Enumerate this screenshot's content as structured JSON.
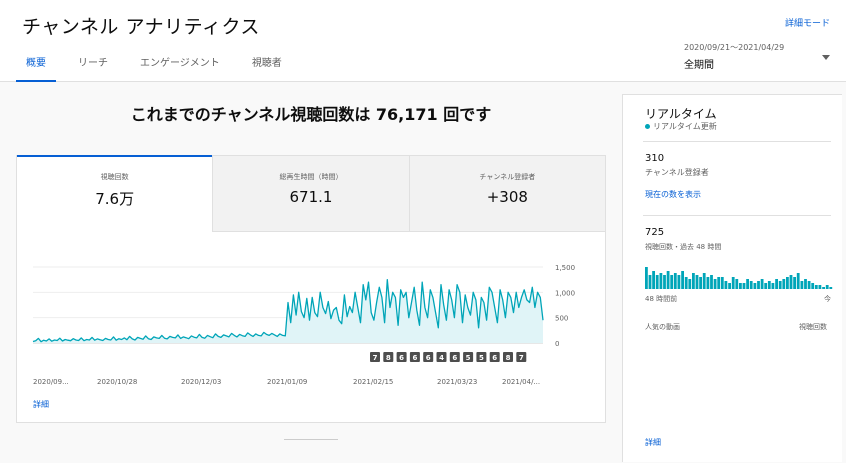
{
  "header": {
    "title": "チャンネル アナリティクス",
    "detail_mode": "詳細モード",
    "tabs": [
      {
        "label": "概要",
        "active": true
      },
      {
        "label": "リーチ",
        "active": false
      },
      {
        "label": "エンゲージメント",
        "active": false
      },
      {
        "label": "視聴者",
        "active": false
      }
    ],
    "date_range": "2020/09/21～2021/04/29",
    "period": "全期間"
  },
  "main": {
    "headline": "これまでのチャンネル視聴回数は 76,171 回です",
    "metrics": [
      {
        "label": "視聴回数",
        "value": "7.6万"
      },
      {
        "label": "総再生時間（時間）",
        "value": "671.1"
      },
      {
        "label": "チャンネル登録者",
        "value": "+308"
      }
    ],
    "detail_link": "詳細"
  },
  "chart_data": {
    "type": "area",
    "series_color": "#00a5b8",
    "fill_color": "#e0f4f7",
    "yticks": [
      "1,500",
      "1,000",
      "500",
      "0"
    ],
    "ylim": [
      0,
      1500
    ],
    "xticks": [
      "2020/09...",
      "2020/10/28",
      "2020/12/03",
      "2021/01/09",
      "2021/02/15",
      "2021/03/23",
      "2021/04/..."
    ],
    "markers": [
      "7",
      "8",
      "6",
      "6",
      "6",
      "4",
      "6",
      "5",
      "5",
      "6",
      "8",
      "7"
    ],
    "values": [
      30,
      45,
      90,
      25,
      55,
      40,
      80,
      35,
      60,
      50,
      95,
      40,
      70,
      55,
      45,
      85,
      60,
      50,
      100,
      45,
      70,
      60,
      110,
      55,
      80,
      65,
      50,
      90,
      70,
      60,
      120,
      55,
      85,
      70,
      100,
      65,
      130,
      80,
      60,
      110,
      90,
      75,
      140,
      85,
      70,
      120,
      100,
      90,
      150,
      95,
      80,
      130,
      110,
      100,
      160,
      90,
      120,
      105,
      85,
      140,
      115,
      100,
      170,
      110,
      95,
      150,
      125,
      105,
      180,
      130,
      110,
      160,
      140,
      120,
      190,
      150,
      120,
      170,
      145,
      130,
      200,
      160,
      130,
      180,
      150,
      140,
      210,
      170,
      150,
      190,
      160,
      130,
      180,
      150,
      140,
      800,
      400,
      950,
      550,
      1000,
      620,
      500,
      880,
      450,
      900,
      600,
      520,
      1000,
      700,
      580,
      820,
      480,
      650,
      700,
      450,
      380,
      950,
      520,
      720,
      600,
      1000,
      700,
      400,
      1150,
      850,
      1200,
      600,
      450,
      800,
      1100,
      900,
      400,
      1250,
      700,
      1000,
      900,
      350,
      1050,
      900,
      1000,
      500,
      800,
      1100,
      650,
      350,
      1200,
      700,
      500,
      1050,
      900,
      600,
      300,
      1150,
      750,
      450,
      1050,
      850,
      500,
      1150,
      1000,
      400,
      950,
      700,
      550,
      1000,
      850,
      300,
      900,
      800,
      450,
      1100,
      1000,
      700,
      400,
      1050,
      850,
      500,
      1000,
      900,
      600,
      1000,
      700,
      900,
      1050,
      850,
      800,
      1100,
      700,
      1000,
      900,
      450
    ]
  },
  "realtime": {
    "title": "リアルタイム",
    "live_label": "リアルタイム更新",
    "subscribers": "310",
    "subscribers_label": "チャンネル登録者",
    "show_current": "現在の数を表示",
    "views": "725",
    "views_label": "視聴回数・過去 48 時間",
    "bars": [
      22,
      14,
      18,
      14,
      16,
      14,
      18,
      14,
      16,
      14,
      18,
      12,
      10,
      16,
      14,
      12,
      16,
      12,
      14,
      10,
      12,
      12,
      8,
      6,
      12,
      10,
      6,
      6,
      10,
      8,
      6,
      8,
      10,
      6,
      8,
      6,
      10,
      8,
      10,
      12,
      14,
      12,
      16,
      8,
      10,
      8,
      6,
      4,
      4,
      2,
      4,
      2
    ],
    "time_start": "48 時間前",
    "time_end": "今",
    "popular_label": "人気の動画",
    "views_col": "視聴回数",
    "detail_link": "詳細"
  }
}
